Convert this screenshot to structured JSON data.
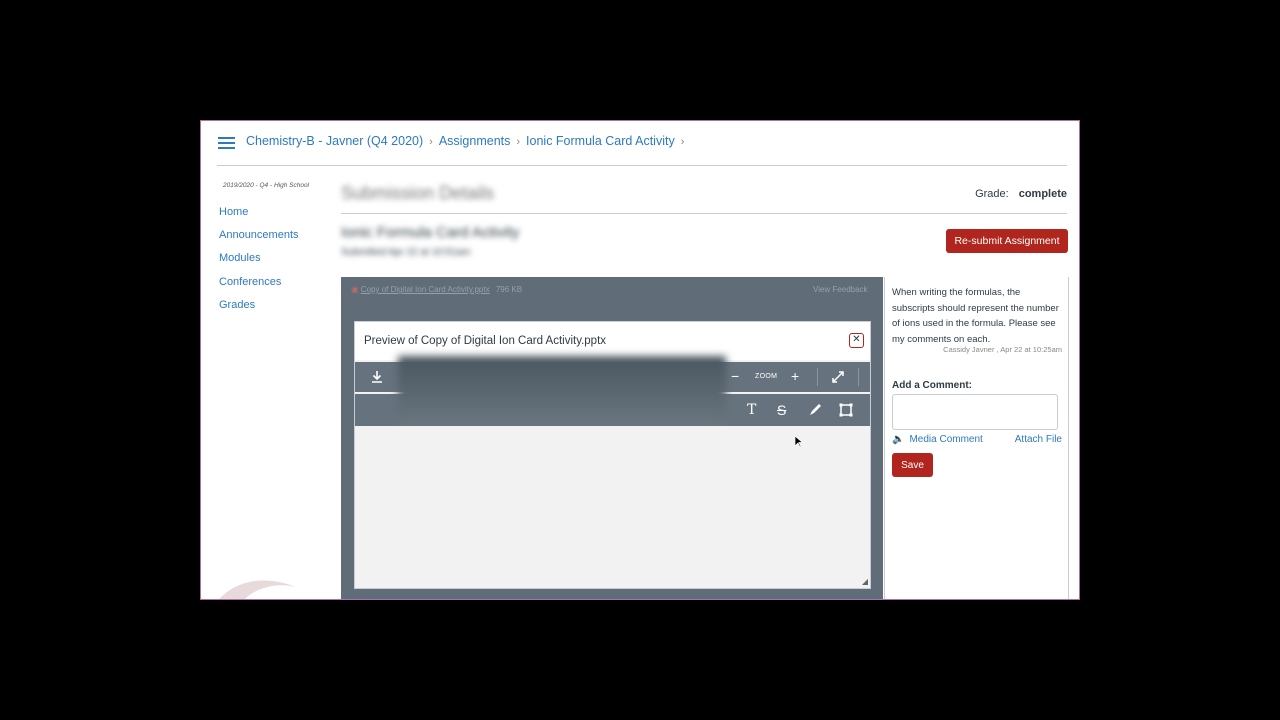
{
  "breadcrumb": {
    "course": "Chemistry-B - Javner (Q4 2020)",
    "assignments": "Assignments",
    "activity": "Ionic Formula Card Activity"
  },
  "nav": {
    "term": "2019/2020 - Q4 - High School",
    "items": [
      "Home",
      "Announcements",
      "Modules",
      "Conferences",
      "Grades"
    ]
  },
  "main": {
    "title": "Submission Details",
    "grade_label": "Grade:",
    "grade_value": "complete",
    "submission_title": "Ionic Formula Card Activity",
    "submission_date": "Submitted Apr 22 at 10:51am",
    "resubmit_label": "Re-submit Assignment"
  },
  "file": {
    "name": "Copy of Digital Ion Card Activity.pptx",
    "size": "796 KB",
    "view_feedback": "View Feedback"
  },
  "preview": {
    "title": "Preview of Copy of Digital Ion Card Activity.pptx",
    "zoom_label": "ZOOM"
  },
  "comments": {
    "text": "When writing the formulas, the subscripts should represent the number of ions used in the formula. Please see my comments on each.",
    "meta": "Cassidy Javner , Apr 22 at 10:25am",
    "add_label": "Add a Comment:",
    "media_label": "Media Comment",
    "attach_label": "Attach File",
    "save_label": "Save"
  },
  "colors": {
    "link": "#2d7abf",
    "brand_red": "#b0261e",
    "toolbar": "#66737e"
  }
}
